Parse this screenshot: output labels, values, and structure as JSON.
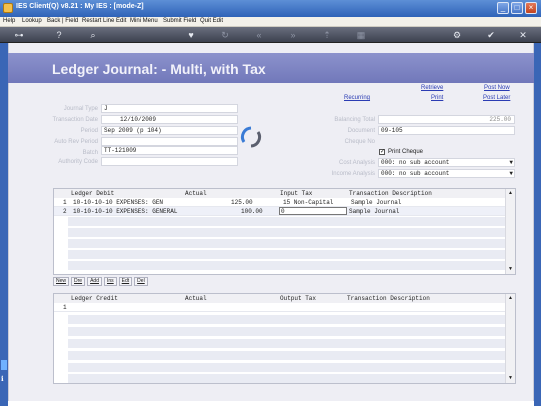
{
  "window": {
    "title": "IES Client(Q) v8.21 : My IES :       [mode-Z]"
  },
  "menu": [
    "Help",
    "Lookup",
    "Back | Field",
    "Restart Line Edit",
    "Mini Menu",
    "Submit Field",
    "Quit Edit"
  ],
  "page_title": "Ledger Journal: - Multi, with Tax",
  "form": {
    "journal_type": {
      "label": "Journal Type",
      "value": "J"
    },
    "transaction_date": {
      "label": "Transaction Date",
      "value": "12/10/2009"
    },
    "period": {
      "label": "Period",
      "value": "Sep 2009 (p 104)"
    },
    "auto_rev_period": {
      "label": "Auto Rev Period",
      "value": ""
    },
    "batch": {
      "label": "Batch",
      "value": "TT-121009"
    },
    "authority_code": {
      "label": "Authority Code",
      "value": ""
    },
    "balancing_total": {
      "label": "Balancing Total",
      "value": "225.00"
    },
    "document": {
      "label": "Document",
      "value": "09-105"
    },
    "cheque_no": {
      "label": "Cheque No",
      "value": ""
    },
    "print_cheque": {
      "label": "Print Cheque",
      "checked": true
    },
    "cost_analysis": {
      "label": "Cost Analysis",
      "value": "000: no sub account"
    },
    "income_analysis": {
      "label": "Income Analysis",
      "value": "000: no sub account"
    }
  },
  "links": {
    "retrieve": "Retrieve",
    "post_now": "Post Now",
    "recurring": "Recurring",
    "print": "Print",
    "post_later": "Post Later"
  },
  "debit_grid": {
    "headers": {
      "ledger": "Ledger Debit",
      "actual": "Actual",
      "tax": "Input Tax",
      "desc": "Transaction Description"
    },
    "rows": [
      {
        "num": "1",
        "ledger": "10-10-10-10 EXPENSES: GEN",
        "actual": "125.00",
        "tax": "15 Non-Capital",
        "desc": "Sample Journal"
      },
      {
        "num": "2",
        "ledger": "10-10-10-10 EXPENSES: GENERAL",
        "actual": "100.00",
        "tax": "0",
        "desc": "Sample Journal"
      }
    ]
  },
  "row_buttons": [
    "New",
    "Dre",
    "Add",
    "Ins",
    "Edt",
    "Del"
  ],
  "credit_grid": {
    "headers": {
      "ledger": "Ledger Credit",
      "actual": "Actual",
      "tax": "Output Tax",
      "desc": "Transaction Description"
    },
    "rows": [
      {
        "num": "1"
      }
    ]
  },
  "colors": {
    "header_band": "#7f86c4",
    "link": "#2b3cb3",
    "titlebar": "#2f63b8"
  }
}
